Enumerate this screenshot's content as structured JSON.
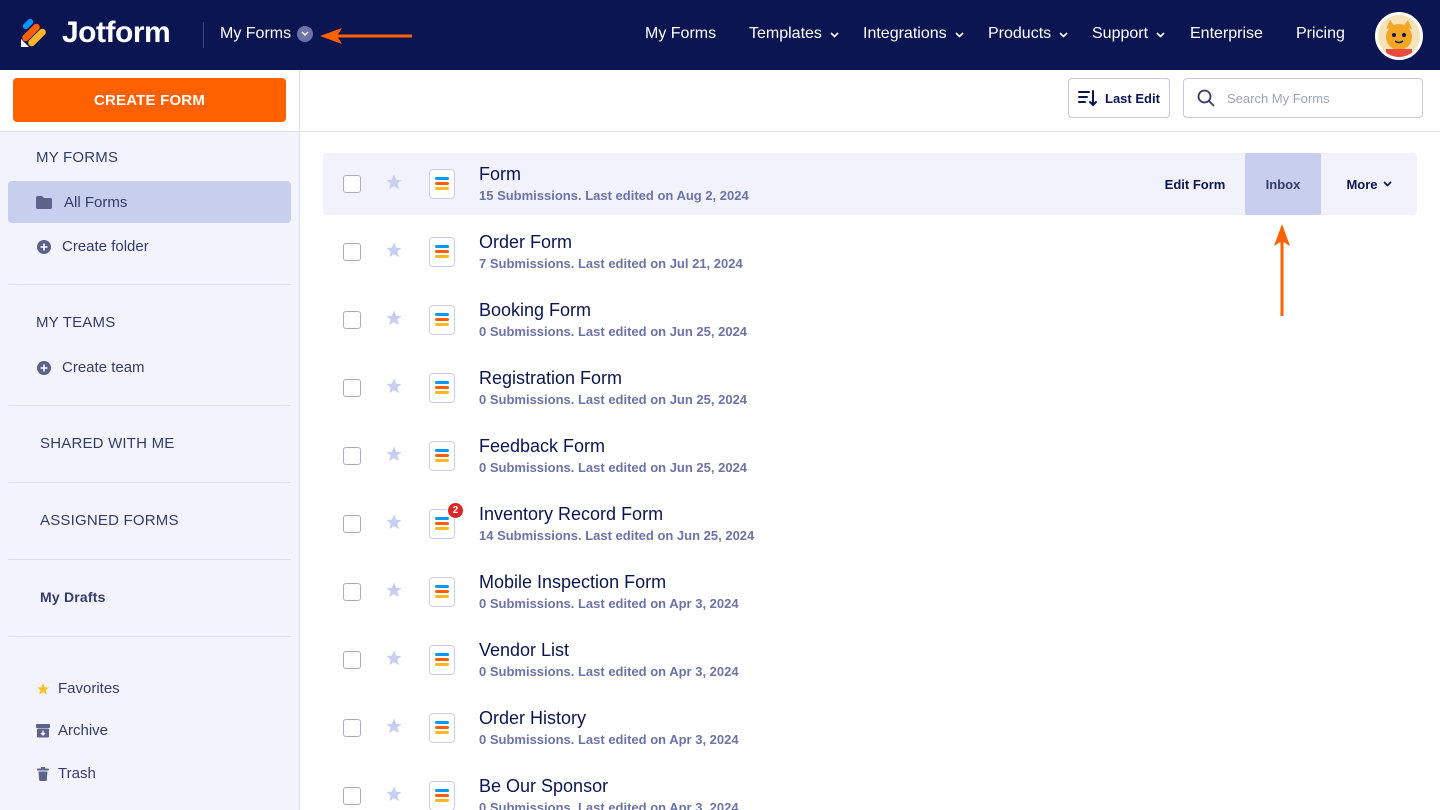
{
  "header": {
    "brand": "Jotform",
    "context_menu_label": "My Forms",
    "nav": [
      {
        "label": "My Forms",
        "has_caret": false
      },
      {
        "label": "Templates",
        "has_caret": true
      },
      {
        "label": "Integrations",
        "has_caret": true
      },
      {
        "label": "Products",
        "has_caret": true
      },
      {
        "label": "Support",
        "has_caret": true
      },
      {
        "label": "Enterprise",
        "has_caret": false
      },
      {
        "label": "Pricing",
        "has_caret": false
      }
    ],
    "colors": {
      "background": "#0a1551",
      "accent": "#ff6100"
    }
  },
  "sidebar": {
    "create_label": "CREATE FORM",
    "my_forms_heading": "MY FORMS",
    "all_forms_label": "All Forms",
    "create_folder_label": "Create folder",
    "my_teams_heading": "MY TEAMS",
    "create_team_label": "Create team",
    "shared_label": "SHARED WITH ME",
    "assigned_label": "ASSIGNED FORMS",
    "drafts_label": "My Drafts",
    "favorites_label": "Favorites",
    "archive_label": "Archive",
    "trash_label": "Trash"
  },
  "toolbar": {
    "sort_label": "Last Edit",
    "search_placeholder": "Search My Forms"
  },
  "row_actions": {
    "edit_label": "Edit Form",
    "inbox_label": "Inbox",
    "more_label": "More"
  },
  "forms": [
    {
      "title": "Form",
      "subtitle": "15 Submissions. Last edited on Aug 2, 2024",
      "badge": ""
    },
    {
      "title": "Order Form",
      "subtitle": "7 Submissions. Last edited on Jul 21, 2024",
      "badge": ""
    },
    {
      "title": "Booking Form",
      "subtitle": "0 Submissions. Last edited on Jun 25, 2024",
      "badge": ""
    },
    {
      "title": "Registration Form",
      "subtitle": "0 Submissions. Last edited on Jun 25, 2024",
      "badge": ""
    },
    {
      "title": "Feedback Form",
      "subtitle": "0 Submissions. Last edited on Jun 25, 2024",
      "badge": ""
    },
    {
      "title": "Inventory Record Form",
      "subtitle": "14 Submissions. Last edited on Jun 25, 2024",
      "badge": "2"
    },
    {
      "title": "Mobile Inspection Form",
      "subtitle": "0 Submissions. Last edited on Apr 3, 2024",
      "badge": ""
    },
    {
      "title": "Vendor List",
      "subtitle": "0 Submissions. Last edited on Apr 3, 2024",
      "badge": ""
    },
    {
      "title": "Order History",
      "subtitle": "0 Submissions. Last edited on Apr 3, 2024",
      "badge": ""
    },
    {
      "title": "Be Our Sponsor",
      "subtitle": "0 Submissions. Last edited on Apr 3, 2024",
      "badge": ""
    }
  ]
}
